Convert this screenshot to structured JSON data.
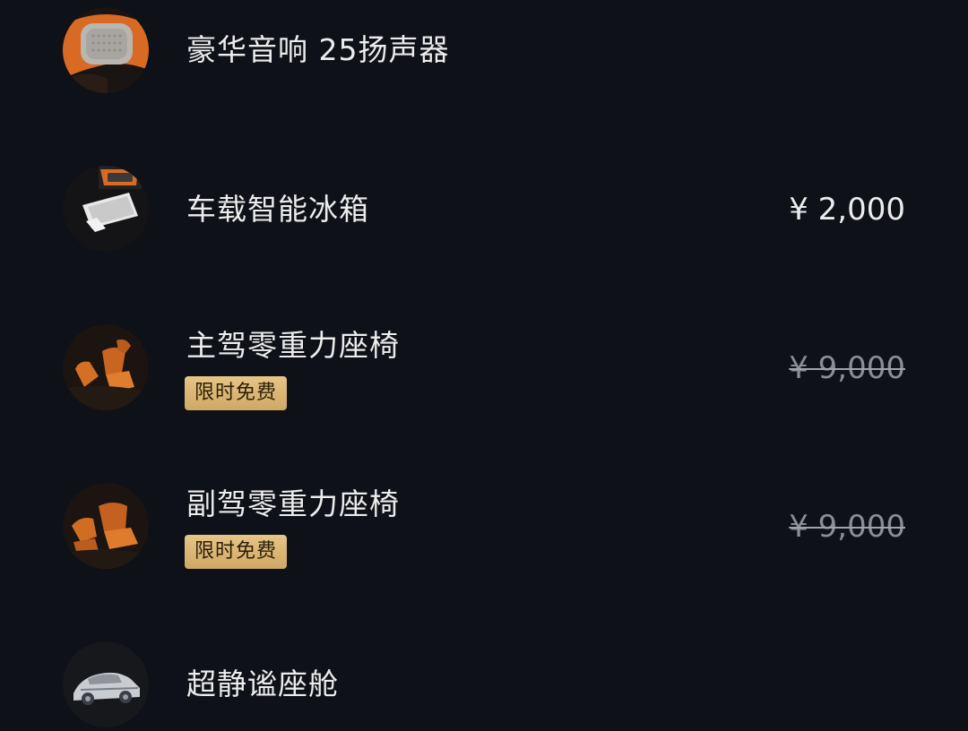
{
  "options": [
    {
      "name": "豪华音响 25扬声器",
      "price": "",
      "badge": "",
      "icon": "speaker-icon"
    },
    {
      "name": "车载智能冰箱",
      "price": "¥ 2,000",
      "badge": "",
      "icon": "fridge-icon"
    },
    {
      "name": "主驾零重力座椅",
      "price": "¥ 9,000",
      "price_struck": true,
      "badge": "限时免费",
      "icon": "seat-icon"
    },
    {
      "name": "副驾零重力座椅",
      "price": "¥ 9,000",
      "price_struck": true,
      "badge": "限时免费",
      "icon": "seat-icon"
    },
    {
      "name": "超静谧座舱",
      "price": "",
      "badge": "",
      "icon": "car-cabin-icon"
    }
  ],
  "colors": {
    "background": "#0e1117",
    "text": "#ececec",
    "struck_price": "#8a8d93",
    "badge_gold": "#d9b673",
    "accent_orange": "#d9742b"
  }
}
